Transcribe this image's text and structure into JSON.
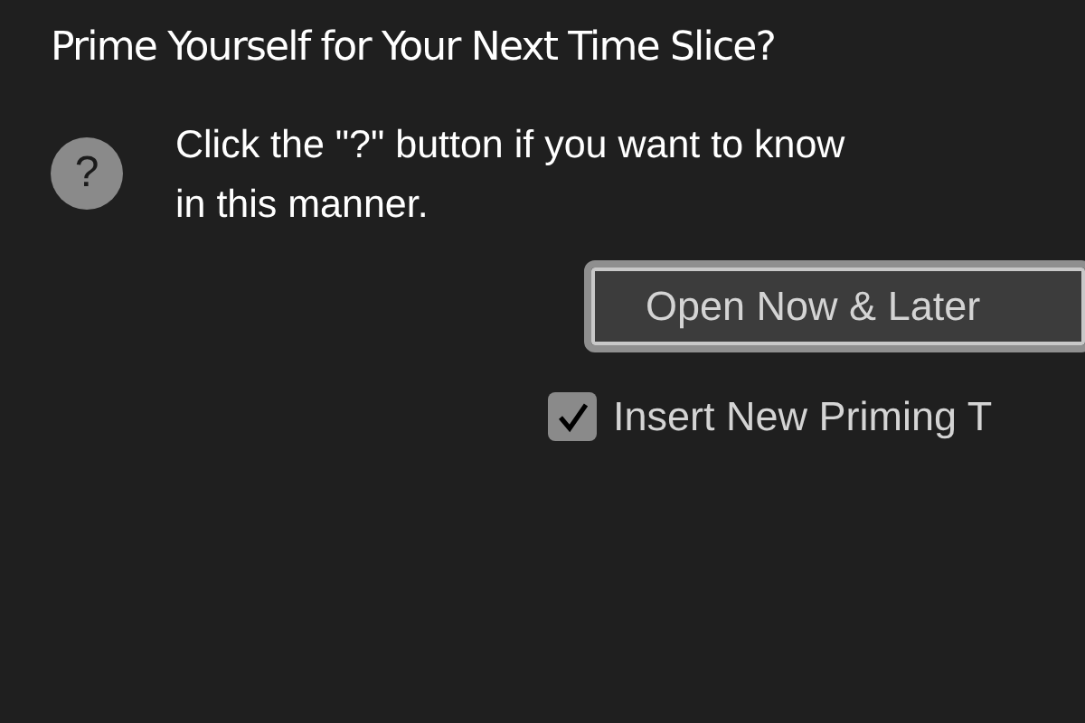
{
  "dialog": {
    "title": "Prime Yourself for Your Next Time Slice?",
    "help_icon": "?",
    "message": [
      "Click the \"?\" button if you want to know",
      "in this manner."
    ],
    "button": "Open Now & Later",
    "checkbox": {
      "label": "Insert New Priming T",
      "checked": true
    }
  }
}
